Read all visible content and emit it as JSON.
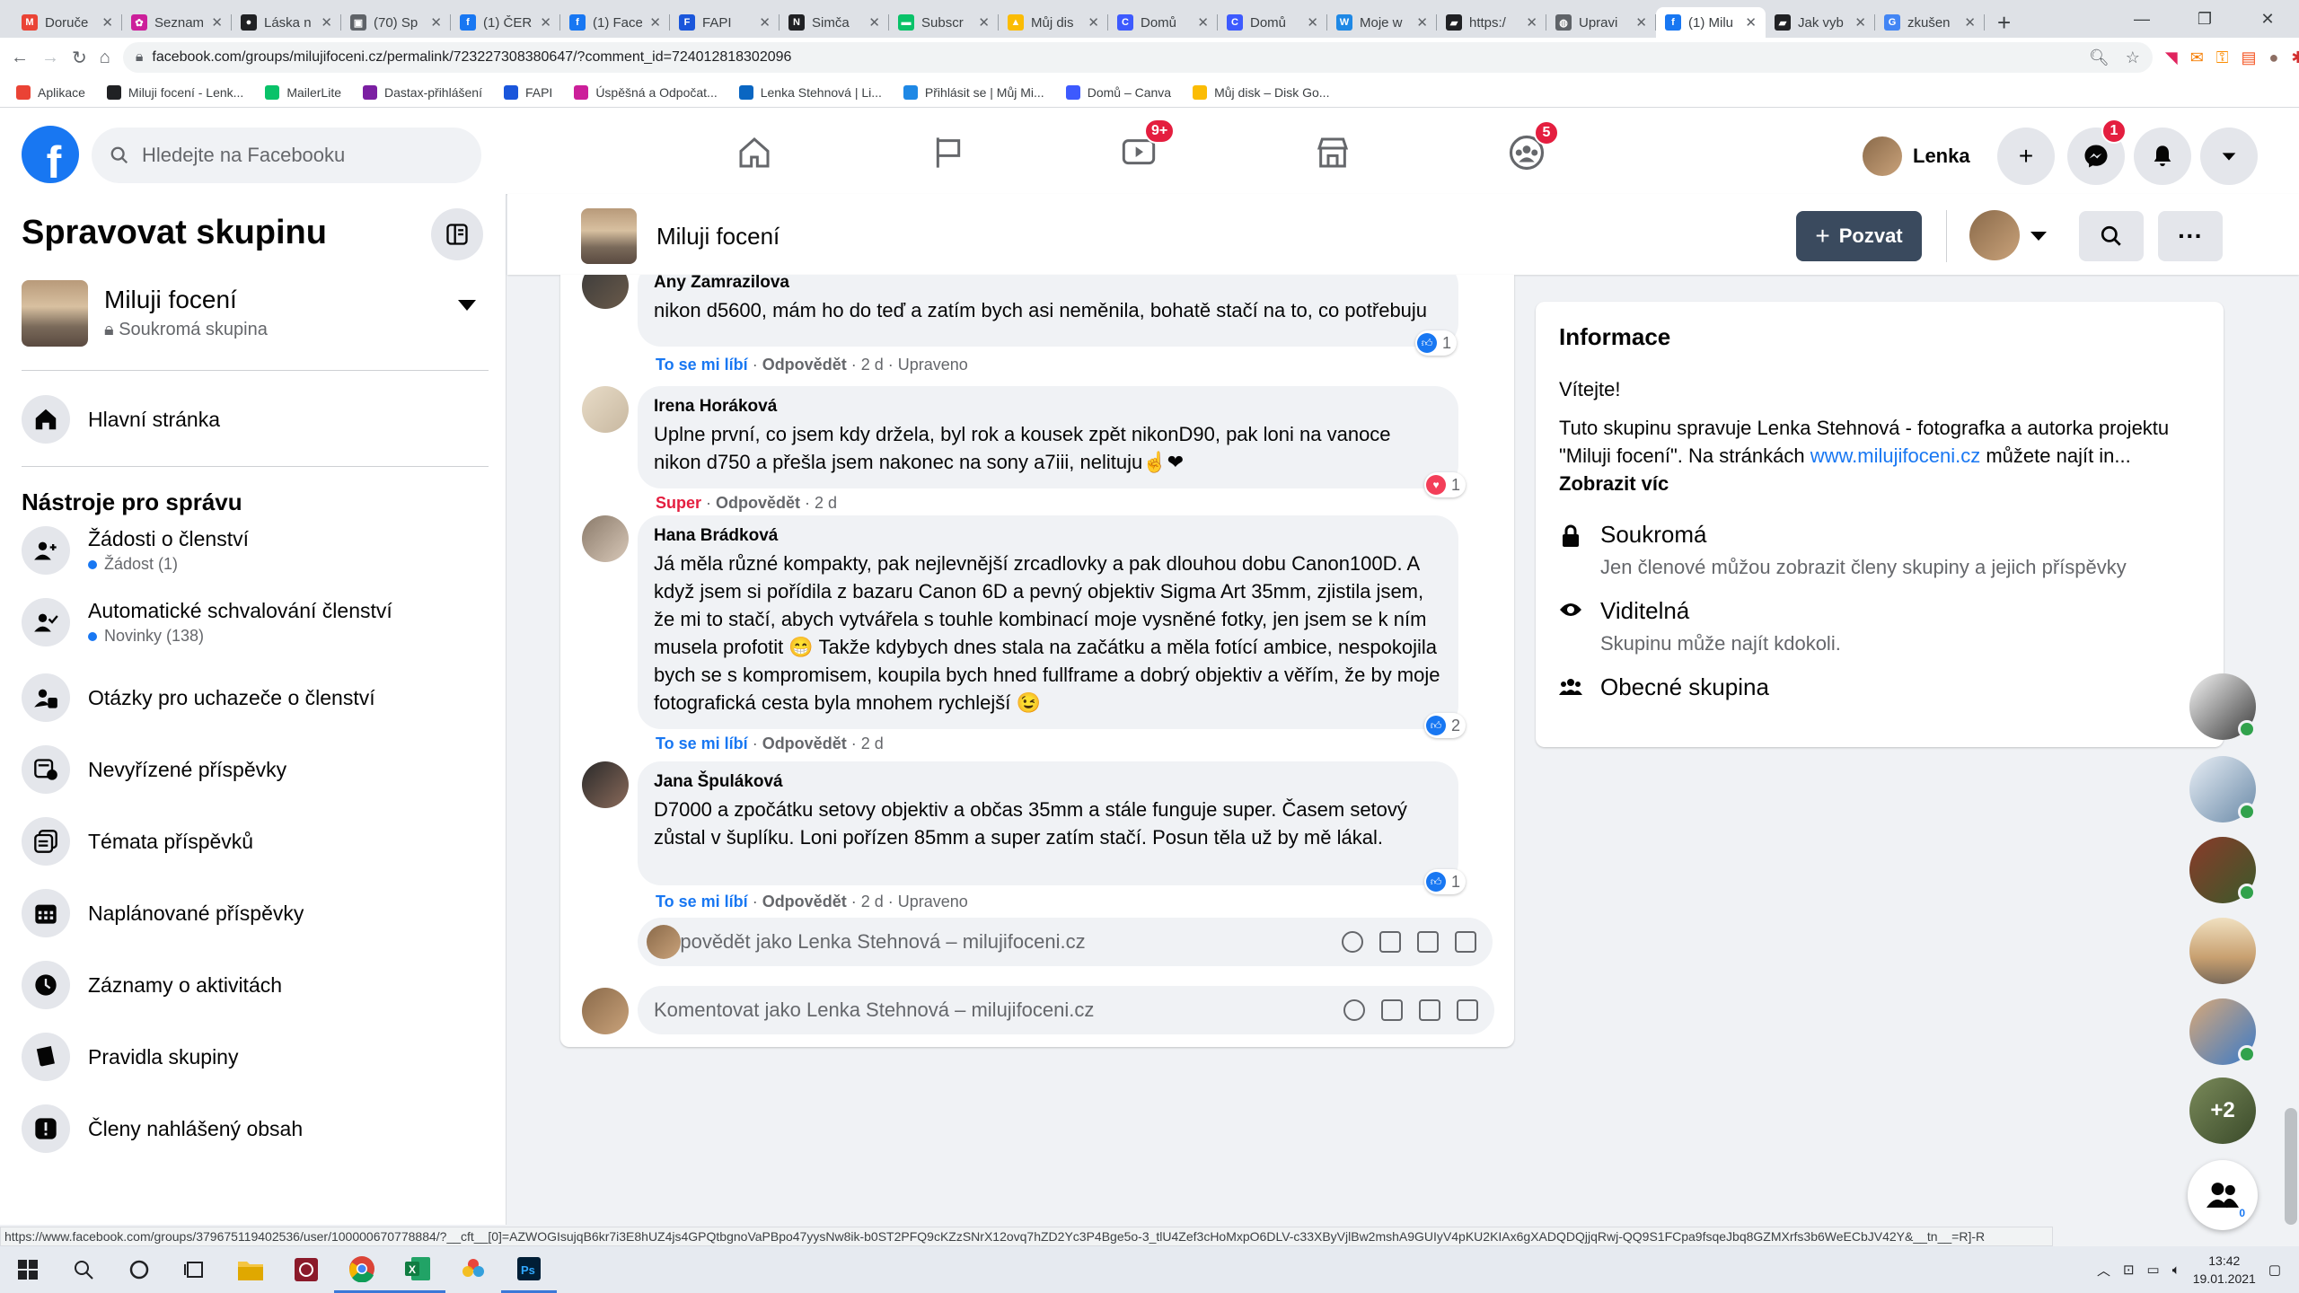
{
  "browser": {
    "tabs": [
      {
        "title": "Doruče",
        "fav": "gmail",
        "color": "#ea4335",
        "letter": "M"
      },
      {
        "title": "Seznam",
        "fav": "seznam",
        "color": "#cc1f9a",
        "letter": "✿"
      },
      {
        "title": "Láska n",
        "fav": "circle",
        "color": "#202124",
        "letter": "●"
      },
      {
        "title": "(70) Sp",
        "fav": "box",
        "color": "#5f6368",
        "letter": "▣"
      },
      {
        "title": "(1) ČER",
        "fav": "facebook",
        "color": "#1877f2",
        "letter": "f"
      },
      {
        "title": "(1) Face",
        "fav": "facebook",
        "color": "#1877f2",
        "letter": "f"
      },
      {
        "title": "FAPI",
        "fav": "fapi",
        "color": "#1a56db",
        "letter": "F"
      },
      {
        "title": "Simča",
        "fav": "notion",
        "color": "#202124",
        "letter": "N"
      },
      {
        "title": "Subscr",
        "fav": "mailerlite",
        "color": "#09c269",
        "letter": "▬"
      },
      {
        "title": "Můj dis",
        "fav": "drive",
        "color": "#fbbc04",
        "letter": "▲"
      },
      {
        "title": "Domů",
        "fav": "canva",
        "color": "#3d5afe",
        "letter": "C"
      },
      {
        "title": "Domů",
        "fav": "canva",
        "color": "#3d5afe",
        "letter": "C"
      },
      {
        "title": "Moje w",
        "fav": "wp",
        "color": "#1e88e5",
        "letter": "W"
      },
      {
        "title": "https:/",
        "fav": "car",
        "color": "#202124",
        "letter": "▰"
      },
      {
        "title": "Upravi",
        "fav": "globe",
        "color": "#5f6368",
        "letter": "◍"
      },
      {
        "title": "(1) Milu",
        "fav": "facebook",
        "color": "#1877f2",
        "letter": "f",
        "active": true
      },
      {
        "title": "Jak vyb",
        "fav": "car",
        "color": "#202124",
        "letter": "▰"
      },
      {
        "title": "zkušen",
        "fav": "google",
        "color": "#4285f4",
        "letter": "G"
      }
    ],
    "url": "facebook.com/groups/milujifoceni.cz/permalink/723227308380647/?comment_id=724012818302096",
    "bookmarks": [
      {
        "label": "Aplikace",
        "color": "#ea4335"
      },
      {
        "label": "Miluji focení - Lenk...",
        "color": "#202124"
      },
      {
        "label": "MailerLite",
        "color": "#09c269"
      },
      {
        "label": "Dastax-přihlášení",
        "color": "#7b1fa2"
      },
      {
        "label": "FAPI",
        "color": "#1a56db"
      },
      {
        "label": "Úspěšná a Odpočat...",
        "color": "#cc1f9a"
      },
      {
        "label": "Lenka Stehnová | Li...",
        "color": "#0a66c2"
      },
      {
        "label": "Přihlásit se | Můj Mi...",
        "color": "#1e88e5"
      },
      {
        "label": "Domů – Canva",
        "color": "#3d5afe"
      },
      {
        "label": "Můj disk – Disk Go...",
        "color": "#fbbc04"
      }
    ],
    "status_url": "https://www.facebook.com/groups/379675119402536/user/100000670778884/?__cft__[0]=AZWOGIsujqB6kr7i3E8hUZ4js4GPQtbgnoVaPBpo47yysNw8ik-b0ST2PFQ9cKZzSNrX12ovq7hZD2Yc3P4Bge5o-3_tlU4Zef3cHoMxpO6DLV-c33XByVjlBw2mshA9GUIyV4pKU2KIAx6gXADQDQjjqRwj-QQ9S1FCpa9fsqeJbq8GZMXrfs3b6WeECbJV42Y&__tn__=R]-R"
  },
  "fb": {
    "search_placeholder": "Hledejte na Facebooku",
    "nav_badges": {
      "watch": "9+",
      "groups": "5"
    },
    "profile_name": "Lenka",
    "messenger_badge": "1"
  },
  "sidebar": {
    "title": "Spravovat skupinu",
    "group_name": "Miluji focení",
    "group_privacy": "Soukromá skupina",
    "home": "Hlavní stránka",
    "section": "Nástroje pro správu",
    "items": [
      {
        "label": "Žádosti o členství",
        "sub": "Žádost (1)",
        "icon": "person-add-icon"
      },
      {
        "label": "Automatické schvalování členství",
        "sub": "Novinky (138)",
        "icon": "person-check-icon"
      },
      {
        "label": "Otázky pro uchazeče o členství",
        "icon": "person-question-icon"
      },
      {
        "label": "Nevyřízené příspěvky",
        "icon": "pending-posts-icon"
      },
      {
        "label": "Témata příspěvků",
        "icon": "topics-icon"
      },
      {
        "label": "Naplánované příspěvky",
        "icon": "calendar-icon"
      },
      {
        "label": "Záznamy o aktivitách",
        "icon": "clock-icon"
      },
      {
        "label": "Pravidla skupiny",
        "icon": "book-icon"
      },
      {
        "label": "Členy nahlášený obsah",
        "icon": "report-icon"
      }
    ]
  },
  "groupbar": {
    "name": "Miluji focení",
    "invite": "Pozvat"
  },
  "comments": [
    {
      "name": "Any Zamrazilova",
      "text": "nikon d5600, mám ho do teď a zatím bych asi neměnila, bohatě stačí na to, co potřebuju",
      "action": "To se mi líbí",
      "reply": "Odpovědět",
      "time": "2 d",
      "edited": "Upraveno",
      "react_count": "1"
    },
    {
      "name": "Irena Horáková",
      "text": "Uplne první, co jsem kdy držela, byl rok a kousek zpět nikonD90, pak loni na vanoce nikon d750 a přešla jsem nakonec na sony a7iii, nelituju☝❤",
      "action": "Super",
      "reply": "Odpovědět",
      "time": "2 d",
      "react_count": "1"
    },
    {
      "name": "Hana Brádková",
      "text": "Já měla různé kompakty, pak nejlevnější zrcadlovky a pak dlouhou dobu Canon100D. A když jsem si pořídila z bazaru Canon 6D a pevný objektiv Sigma Art 35mm, zjistila jsem, že mi to stačí, abych vytvářela s touhle kombinací moje vysněné fotky, jen jsem se k ním musela profotit 😁 Takže kdybych dnes stala na začátku a měla fotící ambice, nespokojila bych se s kompromisem, koupila bych hned fullframe a dobrý objektiv a věřím, že by moje fotografická cesta byla mnohem rychlejší 😉",
      "action": "To se mi líbí",
      "reply": "Odpovědět",
      "time": "2 d",
      "react_count": "2"
    },
    {
      "name": "Jana Špuláková",
      "text": "D7000 a zpočátku setovy objektiv a občas 35mm a stále funguje super. Časem setový zůstal v šuplíku. Loni pořízen 85mm a super zatím stačí. Posun těla už by mě lákal.",
      "action": "To se mi líbí",
      "reply": "Odpovědět",
      "time": "2 d",
      "edited": "Upraveno",
      "react_count": "1"
    }
  ],
  "reply_placeholder": "Odpovědět jako Lenka Stehnová – milujifoceni.cz",
  "comment_placeholder": "Komentovat jako Lenka Stehnová – milujifoceni.cz",
  "info": {
    "title": "Informace",
    "welcome": "Vítejte!",
    "desc_prefix": "Tuto skupinu spravuje Lenka Stehnová - fotografka a autorka projektu \"Miluji focení\". Na stránkách ",
    "desc_link": "www.milujifoceni.cz",
    "desc_suffix": " můžete najít in... ",
    "more": "Zobrazit víc",
    "rows": [
      {
        "heading": "Soukromá",
        "desc": "Jen členové můžou zobrazit členy skupiny a jejich příspěvky",
        "icon": "lock-icon"
      },
      {
        "heading": "Viditelná",
        "desc": "Skupinu může najít kdokoli.",
        "icon": "eye-icon"
      },
      {
        "heading": "Obecné skupina",
        "icon": "people-icon"
      }
    ]
  },
  "contacts": {
    "more": "+2",
    "newchat_badge": "0"
  },
  "taskbar": {
    "time": "13:42",
    "date": "19.01.2021"
  }
}
